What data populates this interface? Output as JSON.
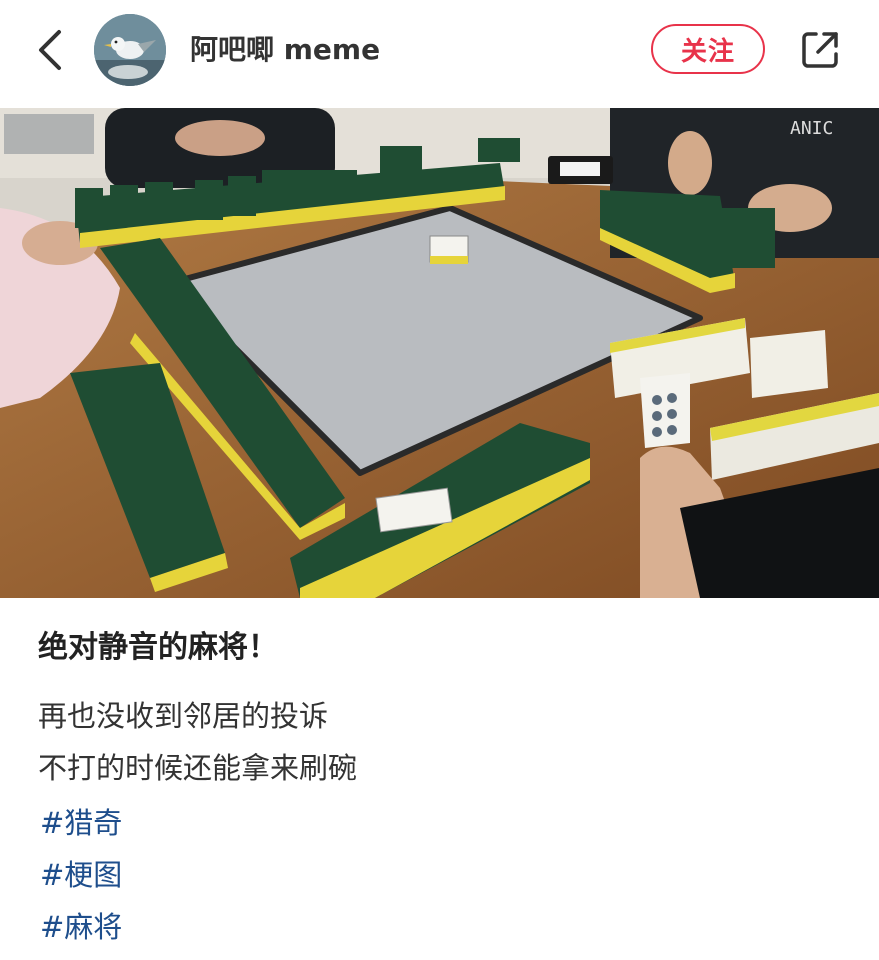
{
  "header": {
    "username": "阿吧唧 meme",
    "follow_label": "关注"
  },
  "photo": {
    "shirt_text": "ANIC"
  },
  "post": {
    "title": "绝对静音的麻将！",
    "lines": [
      "再也没收到邻居的投诉",
      "不打的时候还能拿来刷碗"
    ],
    "tags": [
      "#猎奇",
      "#梗图",
      "#麻将"
    ]
  },
  "colors": {
    "accent": "#e8334a",
    "tag": "#1e4e8c",
    "sponge_green": "#1f4d33",
    "sponge_yellow": "#e6d43a",
    "table_wood": "#9a6230",
    "mat_gray": "#b9bcc0"
  }
}
